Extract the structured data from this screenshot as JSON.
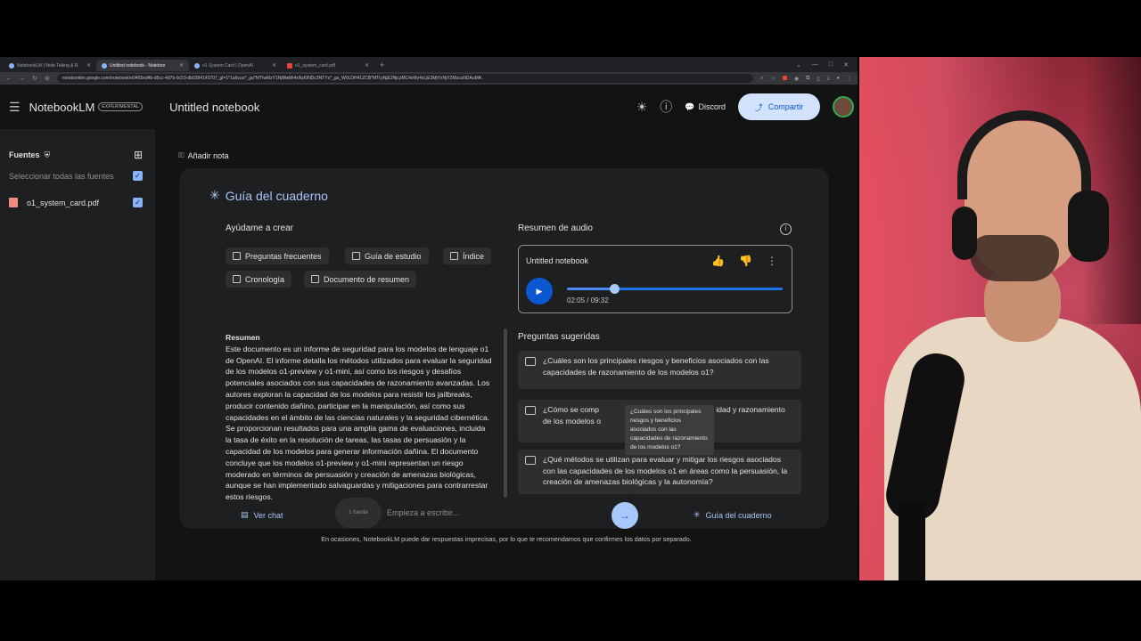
{
  "browser": {
    "tabs": [
      {
        "title": "NotebookLM | Note Taking & R",
        "active": false
      },
      {
        "title": "Untitled notebook - Noteboo",
        "active": true
      },
      {
        "title": "o1 System Card | OpenAI",
        "active": false
      },
      {
        "title": "o1_system_card.pdf",
        "active": false
      }
    ],
    "url": "notebooklm.google.com/notebook/e0465ed4b-d5cc-4d7b-9c53-db0394143707_gl=1*1a6yuo*_ga*MTIwMzY1NjMwMi4xNzI0NDc3NTYx*_ga_W0LDH41ZCB*MTcyNjE2NjczMC4xMy4xLjE3MjYxNjY2MzcuNDAuMA.."
  },
  "header": {
    "brand": "NotebookLM",
    "badge": "EXPERIMENTAL",
    "title": "Untitled notebook",
    "discord": "Discord",
    "share": "Compartir"
  },
  "sidebar": {
    "heading": "Fuentes",
    "select_all": "Seleccionar todas las fuentes",
    "sources": [
      {
        "name": "o1_system_card.pdf",
        "checked": true
      }
    ]
  },
  "main": {
    "add_note": "Añadir nota",
    "guide_title": "Guía del cuaderno",
    "help_create": "Ayúdame a crear",
    "chips": [
      "Preguntas frecuentes",
      "Guía de estudio",
      "Índice",
      "Cronología",
      "Documento de resumen"
    ],
    "summary_heading": "Resumen",
    "summary_text": "Este documento es un informe de seguridad para los modelos de lenguaje o1 de OpenAI. El informe detalla los métodos utilizados para evaluar la seguridad de los modelos o1-preview y o1-mini, así como los riesgos y desafíos potenciales asociados con sus capacidades de razonamiento avanzadas. Los autores exploran la capacidad de los modelos para resistir los jailbreaks, producir contenido dañino, participar en la manipulación, así como sus capacidades en el ámbito de las ciencias naturales y la seguridad cibernética. Se proporcionan resultados para una amplia gama de evaluaciones, incluida la tasa de éxito en la resolución de tareas, las tasas de persuasión y la capacidad de los modelos para generar información dañina. El documento concluye que los modelos o1-preview y o1-mini representan un riesgo moderado en términos de persuasión y creación de amenazas biológicas, aunque se han implementado salvaguardas y mitigaciones para contrarrestar estos riesgos.",
    "audio_heading": "Resumen de audio",
    "audio": {
      "title": "Untitled notebook",
      "time": "02:05 / 09:32",
      "progress": 0.219
    },
    "suggested_heading": "Preguntas sugeridas",
    "questions": [
      "¿Cuáles son los principales riesgos y beneficios asociados con las capacidades de razonamiento de los modelos o1?",
      "¿Cómo se comp                                                       idad y razonamiento de los modelos o",
      "¿Qué métodos se utilizan para evaluar y mitigar los riesgos asociados con las capacidades de los modelos o1 en áreas como la persuasión, la creación de amenazas biológicas y la autonomía?"
    ],
    "tooltip": "¿Cuáles son los principales riesgos y beneficios asociados con las capacidades de razonamiento de los modelos o1?",
    "ver_chat": "Ver chat",
    "source_count": "1 fuente",
    "input_placeholder": "Empieza a escribir...",
    "guide_button": "Guía del cuaderno",
    "disclaimer": "En ocasiones, NotebookLM puede dar respuestas imprecisas, por lo que te recomendamos que confirmes los datos por separado."
  }
}
